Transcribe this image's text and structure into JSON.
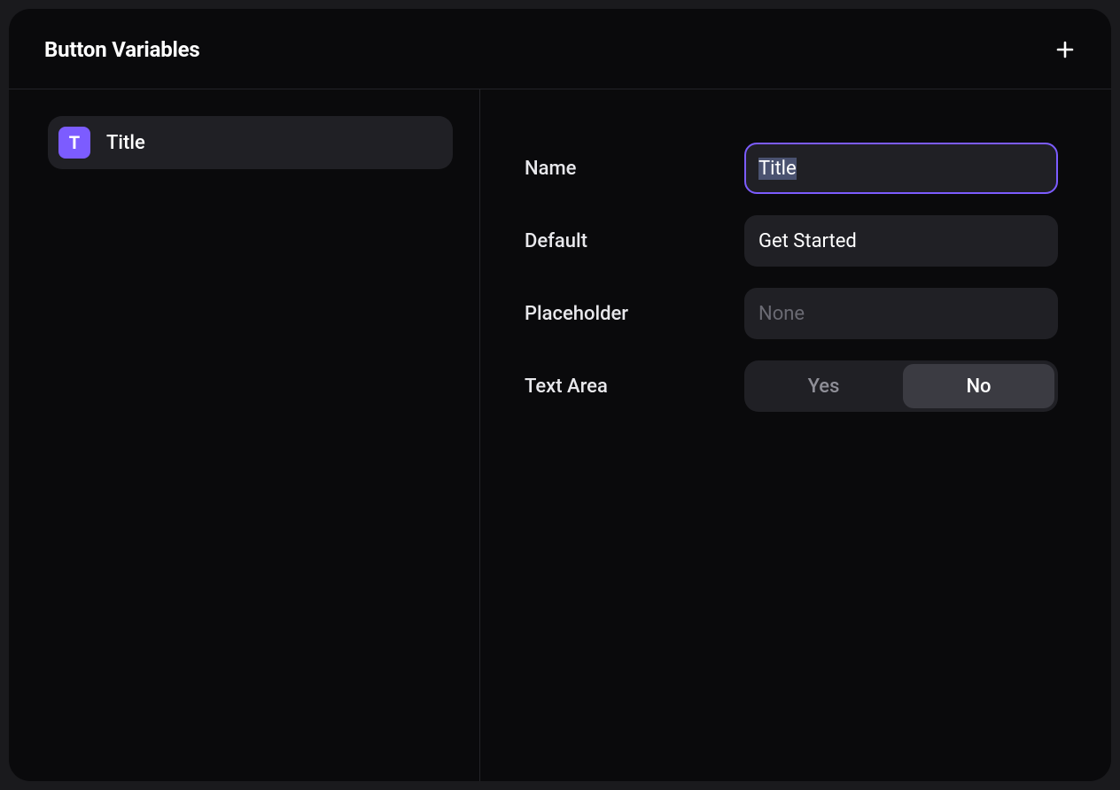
{
  "header": {
    "title": "Button Variables"
  },
  "sidebar": {
    "items": [
      {
        "icon_letter": "T",
        "label": "Title"
      }
    ]
  },
  "form": {
    "name": {
      "label": "Name",
      "value": "Title"
    },
    "default": {
      "label": "Default",
      "value": "Get Started"
    },
    "placeholder": {
      "label": "Placeholder",
      "value": "",
      "placeholder": "None"
    },
    "textarea": {
      "label": "Text Area",
      "options": {
        "yes": "Yes",
        "no": "No"
      },
      "selected": "No"
    }
  },
  "colors": {
    "accent": "#7c5cff"
  }
}
